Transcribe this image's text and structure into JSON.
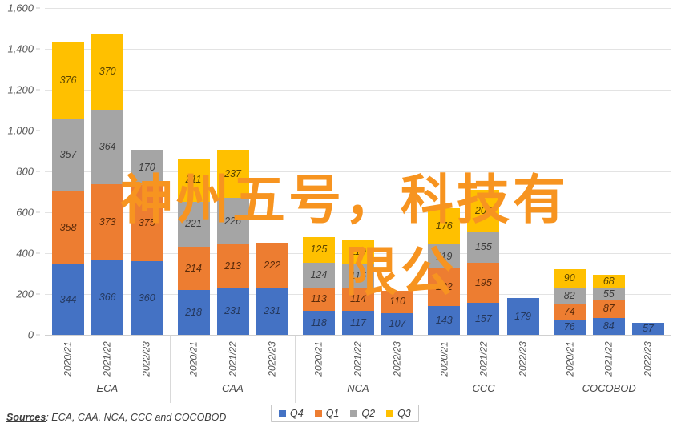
{
  "chart_data": {
    "type": "bar",
    "subtype": "stacked-grouped-column",
    "title": "",
    "xlabel": "",
    "ylabel": "",
    "ylim": [
      0,
      1600
    ],
    "ytick_step": 200,
    "ytick_labels": [
      "1,600",
      "1,400",
      "1,200",
      "1,000",
      "800",
      "600",
      "400",
      "200",
      "0"
    ],
    "ytick_values": [
      1600,
      1400,
      1200,
      1000,
      800,
      600,
      400,
      200,
      0
    ],
    "grid": true,
    "legend_position": "bottom-right",
    "series": [
      {
        "name": "Q4",
        "color": "#4472C4"
      },
      {
        "name": "Q1",
        "color": "#ED7D31"
      },
      {
        "name": "Q2",
        "color": "#A5A5A5"
      },
      {
        "name": "Q3",
        "color": "#FFC000"
      }
    ],
    "group_names": [
      "ECA",
      "CAA",
      "NCA",
      "CCC",
      "COCOBOD"
    ],
    "period_labels": [
      "2020/21",
      "2021/22",
      "2022/23"
    ],
    "groups": [
      {
        "name": "ECA",
        "bars": [
          {
            "period": "2020/21",
            "Q4": 344,
            "Q1": 358,
            "Q2": 357,
            "Q3": 376
          },
          {
            "period": "2021/22",
            "Q4": 366,
            "Q1": 373,
            "Q2": 364,
            "Q3": 370
          },
          {
            "period": "2022/23",
            "Q4": 360,
            "Q1": 375,
            "Q2": 170,
            "Q3": 0
          }
        ]
      },
      {
        "name": "CAA",
        "bars": [
          {
            "period": "2020/21",
            "Q4": 218,
            "Q1": 214,
            "Q2": 221,
            "Q3": 211
          },
          {
            "period": "2021/22",
            "Q4": 231,
            "Q1": 213,
            "Q2": 226,
            "Q3": 237
          },
          {
            "period": "2022/23",
            "Q4": 231,
            "Q1": 222,
            "Q2": 0,
            "Q3": 0
          }
        ]
      },
      {
        "name": "NCA",
        "bars": [
          {
            "period": "2020/21",
            "Q4": 118,
            "Q1": 113,
            "Q2": 124,
            "Q3": 125
          },
          {
            "period": "2021/22",
            "Q4": 117,
            "Q1": 114,
            "Q2": 116,
            "Q3": 119
          },
          {
            "period": "2022/23",
            "Q4": 107,
            "Q1": 110,
            "Q2": 0,
            "Q3": 0
          }
        ]
      },
      {
        "name": "CCC",
        "bars": [
          {
            "period": "2020/21",
            "Q4": 143,
            "Q1": 182,
            "Q2": 119,
            "Q3": 176
          },
          {
            "period": "2021/22",
            "Q4": 157,
            "Q1": 195,
            "Q2": 155,
            "Q3": 203
          },
          {
            "period": "2022/23",
            "Q4": 179,
            "Q1": 0,
            "Q2": 0,
            "Q3": 0
          }
        ]
      },
      {
        "name": "COCOBOD",
        "bars": [
          {
            "period": "2020/21",
            "Q4": 76,
            "Q1": 74,
            "Q2": 82,
            "Q3": 90
          },
          {
            "period": "2021/22",
            "Q4": 84,
            "Q1": 87,
            "Q2": 55,
            "Q3": 68
          },
          {
            "period": "2022/23",
            "Q4": 57,
            "Q1": 0,
            "Q2": 0,
            "Q3": 0
          }
        ]
      }
    ]
  },
  "legend": {
    "items": [
      {
        "label": "Q4",
        "color": "#4472C4"
      },
      {
        "label": "Q1",
        "color": "#ED7D31"
      },
      {
        "label": "Q2",
        "color": "#A5A5A5"
      },
      {
        "label": "Q3",
        "color": "#FFC000"
      }
    ]
  },
  "footer": {
    "sources_label": "Sources",
    "sources_text": ": ECA, CAA, NCA, CCC and COCOBOD"
  },
  "watermark": {
    "line1": "神州五号，科技有",
    "line2": "限公",
    "color": "#F79420"
  }
}
